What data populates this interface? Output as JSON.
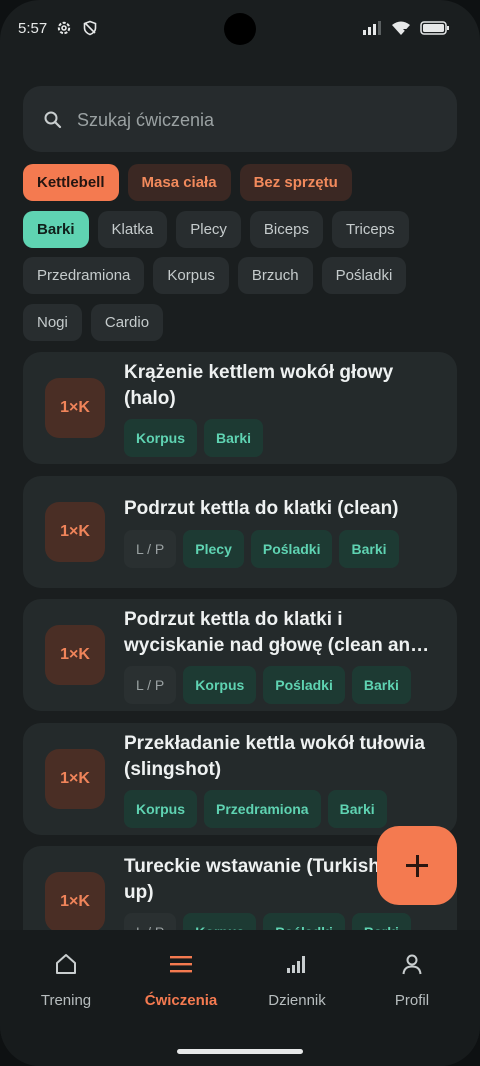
{
  "status_bar": {
    "time": "5:57"
  },
  "search": {
    "placeholder": "Szukaj ćwiczenia"
  },
  "equipment_filters": [
    {
      "label": "Kettlebell",
      "active": true
    },
    {
      "label": "Masa ciała",
      "active": false
    },
    {
      "label": "Bez sprzętu",
      "active": false
    }
  ],
  "muscle_filters": [
    {
      "label": "Barki",
      "active": true
    },
    {
      "label": "Klatka",
      "active": false
    },
    {
      "label": "Plecy",
      "active": false
    },
    {
      "label": "Biceps",
      "active": false
    },
    {
      "label": "Triceps",
      "active": false
    },
    {
      "label": "Przedramiona",
      "active": false
    },
    {
      "label": "Korpus",
      "active": false
    },
    {
      "label": "Brzuch",
      "active": false
    },
    {
      "label": "Pośladki",
      "active": false
    },
    {
      "label": "Nogi",
      "active": false
    },
    {
      "label": "Cardio",
      "active": false
    }
  ],
  "exercises": [
    {
      "badge": "1×K",
      "title": "Krążenie kettlem wokół głowy (halo)",
      "tags": [
        "Korpus",
        "Barki"
      ],
      "lp": false
    },
    {
      "badge": "1×K",
      "title": "Podrzut kettla do klatki (clean)",
      "tags": [
        "Plecy",
        "Pośladki",
        "Barki"
      ],
      "lp": true
    },
    {
      "badge": "1×K",
      "title": "Podrzut kettla do klatki i wyciskanie nad głowę (clean an…",
      "tags": [
        "Korpus",
        "Pośladki",
        "Barki"
      ],
      "lp": true
    },
    {
      "badge": "1×K",
      "title": "Przekładanie kettla wokół tułowia (slingshot)",
      "tags": [
        "Korpus",
        "Przedramiona",
        "Barki"
      ],
      "lp": false
    },
    {
      "badge": "1×K",
      "title": "Tureckie wstawanie (Turkish get-up)",
      "tags": [
        "Korpus",
        "Pośladki",
        "Barki"
      ],
      "lp": true
    }
  ],
  "lp_label": "L / P",
  "nav": [
    {
      "label": "Trening",
      "icon": "home-icon",
      "active": false
    },
    {
      "label": "Ćwiczenia",
      "icon": "list-icon",
      "active": true
    },
    {
      "label": "Dziennik",
      "icon": "bar-chart-icon",
      "active": false
    },
    {
      "label": "Profil",
      "icon": "person-icon",
      "active": false
    }
  ],
  "colors": {
    "accent": "#f47a50",
    "green": "#5fd3b2",
    "background": "#1a1e1f",
    "card": "#242a2b"
  }
}
